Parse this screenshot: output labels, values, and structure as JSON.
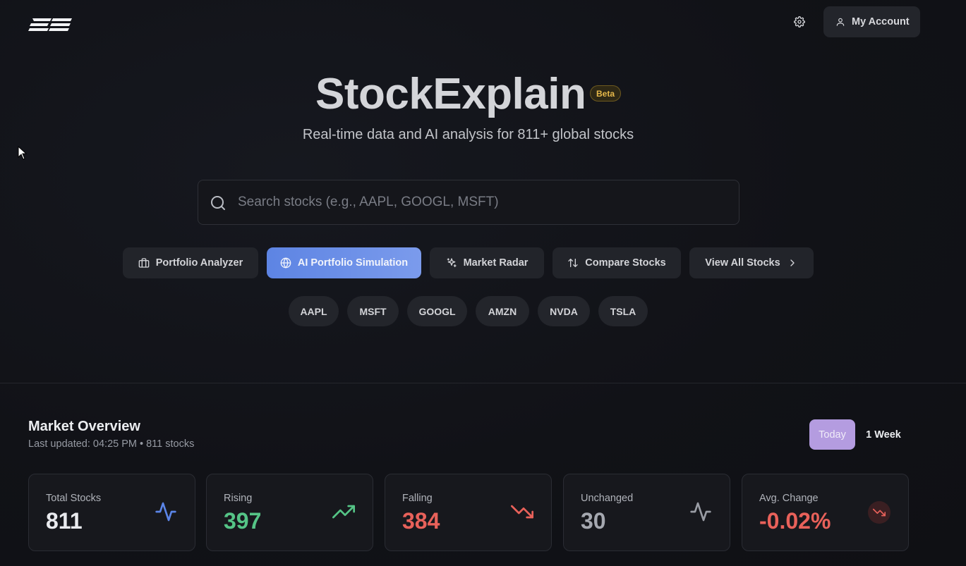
{
  "header": {
    "logo_text": "SE",
    "account_label": "My Account"
  },
  "hero": {
    "title": "StockExplain",
    "badge": "Beta",
    "subtitle": "Real-time data and AI analysis for 811+ global stocks"
  },
  "search": {
    "placeholder": "Search stocks (e.g., AAPL, GOOGL, MSFT)",
    "value": ""
  },
  "actions": [
    {
      "label": "Portfolio Analyzer",
      "icon": "briefcase-icon"
    },
    {
      "label": "AI Portfolio Simulation",
      "icon": "globe-icon",
      "active": true
    },
    {
      "label": "Market Radar",
      "icon": "sparkles-icon"
    },
    {
      "label": "Compare Stocks",
      "icon": "arrows-up-down-icon"
    },
    {
      "label": "View All Stocks",
      "icon": "chevron-right-icon"
    }
  ],
  "tickers": [
    "AAPL",
    "MSFT",
    "GOOGL",
    "AMZN",
    "NVDA",
    "TSLA"
  ],
  "overview": {
    "title": "Market Overview",
    "meta": "Last updated: 04:25 PM • 811 stocks",
    "periods": {
      "today": "Today",
      "week": "1 Week",
      "selected": "Today"
    }
  },
  "stats": [
    {
      "label": "Total Stocks",
      "value": "811",
      "icon": "activity-icon",
      "color": "#e9eaee",
      "icon_color": "#5b85e8"
    },
    {
      "label": "Rising",
      "value": "397",
      "icon": "trending-up-icon",
      "color": "#55c486",
      "icon_color": "#55c486"
    },
    {
      "label": "Falling",
      "value": "384",
      "icon": "trending-down-icon",
      "color": "#e8615a",
      "icon_color": "#e8615a"
    },
    {
      "label": "Unchanged",
      "value": "30",
      "icon": "activity-icon",
      "color": "#a5a8b0",
      "icon_color": "#9a9da5"
    },
    {
      "label": "Avg. Change",
      "value": "-0.02%",
      "icon": "trending-down-icon",
      "color": "#e8615a",
      "icon_color": "#e8615a"
    }
  ]
}
